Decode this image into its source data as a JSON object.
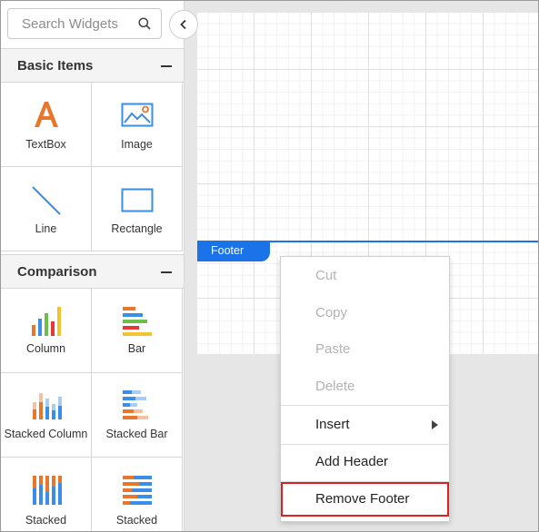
{
  "search": {
    "placeholder": "Search Widgets"
  },
  "sections": [
    {
      "title": "Basic Items",
      "items": [
        "TextBox",
        "Image",
        "Line",
        "Rectangle"
      ]
    },
    {
      "title": "Comparison",
      "items": [
        "Column",
        "Bar",
        "Stacked Column",
        "Stacked Bar",
        "Stacked",
        "Stacked"
      ]
    }
  ],
  "canvas": {
    "footer_label": "Footer"
  },
  "context_menu": {
    "items": [
      {
        "label": "Cut",
        "enabled": false
      },
      {
        "label": "Copy",
        "enabled": false
      },
      {
        "label": "Paste",
        "enabled": false
      },
      {
        "label": "Delete",
        "enabled": false
      },
      {
        "label": "Insert",
        "enabled": true,
        "submenu": true
      },
      {
        "label": "Add Header",
        "enabled": true
      },
      {
        "label": "Remove Footer",
        "enabled": true,
        "highlighted": true
      }
    ]
  },
  "colors": {
    "accent": "#1a73e8",
    "highlight_border": "#e02020"
  }
}
